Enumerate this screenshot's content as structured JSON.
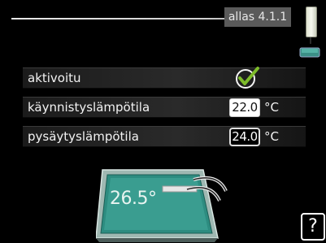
{
  "header": {
    "menu_id": "allas 4.1.1"
  },
  "icons": {
    "scroll": "scrollbar-thumb-icon",
    "mini_pool": "pool-icon",
    "check": "checkmark-icon",
    "help": "help-icon"
  },
  "rows": [
    {
      "label": "aktivoitu",
      "checked": true
    },
    {
      "label": "käynnistyslämpötila",
      "value": "22.0",
      "unit": "°C"
    },
    {
      "label": "pysäytyslämpötila",
      "value": "24.0",
      "unit": "°C"
    }
  ],
  "pool": {
    "temperature": "26.5°"
  },
  "help": {
    "label": "?"
  },
  "colors": {
    "background": "#000000",
    "pool_water": "#2d8c80",
    "check_green": "#7dbb2a",
    "menu_tab": "#5a5a5a"
  }
}
